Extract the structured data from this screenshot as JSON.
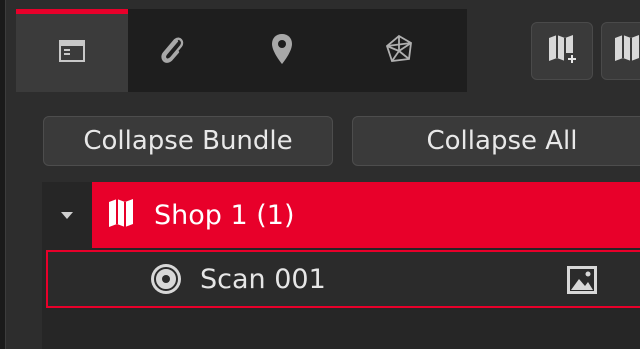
{
  "tabs": [
    {
      "icon": "panel-icon",
      "active": true
    },
    {
      "icon": "paperclip-icon",
      "active": false
    },
    {
      "icon": "location-pin-icon",
      "active": false
    },
    {
      "icon": "network-icon",
      "active": false
    }
  ],
  "toolbar": [
    {
      "icon": "new-bundle-icon"
    },
    {
      "icon": "bundle-icon"
    }
  ],
  "buttons": {
    "collapse_bundle": "Collapse Bundle",
    "collapse_all": "Collapse All"
  },
  "tree": {
    "bundle": {
      "label": "Shop 1 (1)",
      "expanded": true,
      "icon": "map-bundle-icon"
    },
    "scan": {
      "label": "Scan 001",
      "icon": "scan-disc-icon",
      "trailing_icon": "image-icon"
    }
  },
  "colors": {
    "accent": "#e8002a",
    "background": "#2d2d2d",
    "tab_dark": "#1e1e1e",
    "button": "#3a3a3a",
    "text": "#e8e8e8"
  }
}
